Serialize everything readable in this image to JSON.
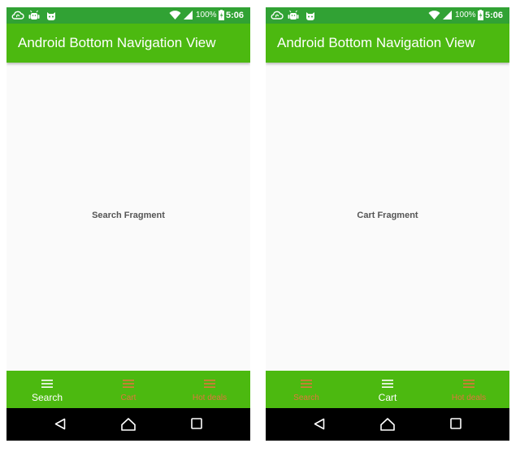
{
  "colors": {
    "status_bar": "#31a234",
    "app_bar": "#4cb910",
    "bottom_nav": "#4cb910",
    "active_item": "#ffffff",
    "inactive_item": "#e0763c"
  },
  "screens": [
    {
      "status_bar": {
        "icons": [
          "cloud-sync-icon",
          "android-debug-icon",
          "cat-icon",
          "wifi-icon",
          "signal-icon",
          "battery-charging-icon"
        ],
        "battery": "100%",
        "time": "5:06"
      },
      "app_bar": {
        "title": "Android Bottom Navigation View"
      },
      "content": {
        "text": "Search Fragment"
      },
      "bottom_nav": {
        "selected": "Search",
        "items": [
          {
            "label": "Search",
            "icon": "menu-icon",
            "active": true
          },
          {
            "label": "Cart",
            "icon": "menu-icon",
            "active": false
          },
          {
            "label": "Hot deals",
            "icon": "menu-icon",
            "active": false
          }
        ]
      },
      "system_nav": [
        "back-icon",
        "home-icon",
        "recents-icon"
      ]
    },
    {
      "status_bar": {
        "icons": [
          "cloud-sync-icon",
          "android-debug-icon",
          "cat-icon",
          "wifi-icon",
          "signal-icon",
          "battery-charging-icon"
        ],
        "battery": "100%",
        "time": "5:06"
      },
      "app_bar": {
        "title": "Android Bottom Navigation View"
      },
      "content": {
        "text": "Cart Fragment"
      },
      "bottom_nav": {
        "selected": "Cart",
        "items": [
          {
            "label": "Search",
            "icon": "menu-icon",
            "active": false
          },
          {
            "label": "Cart",
            "icon": "menu-icon",
            "active": true
          },
          {
            "label": "Hot deals",
            "icon": "menu-icon",
            "active": false
          }
        ]
      },
      "system_nav": [
        "back-icon",
        "home-icon",
        "recents-icon"
      ]
    }
  ]
}
